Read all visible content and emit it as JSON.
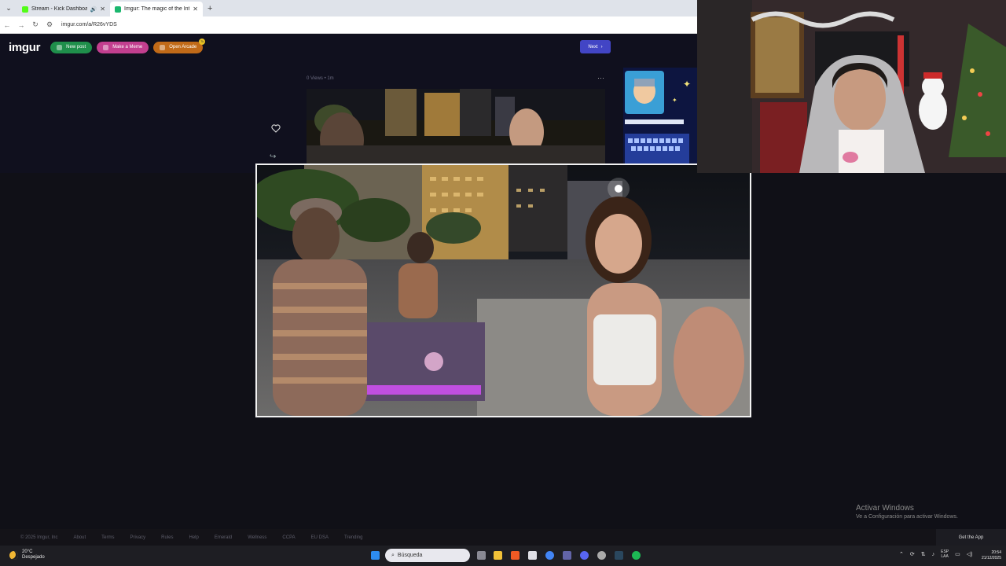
{
  "browser": {
    "tabs": [
      {
        "title": "Stream - Kick Dashboard",
        "favicon_color": "#53fc18"
      },
      {
        "title": "Imgur: The magic of the Internet",
        "favicon_color": "#1bb76e"
      }
    ],
    "url": "imgur.com/a/R26vYDS"
  },
  "imgur": {
    "logo": "imgur",
    "new_post": "New post",
    "make_meme": "Make a Meme",
    "open_arcade": "Open Arcade",
    "arcade_badge": "7k",
    "next": "Next",
    "post_meta": "0 Views • 1m"
  },
  "footer": {
    "copyright": "© 2025 Imgur, Inc",
    "links": [
      "About",
      "Terms",
      "Privacy",
      "Rules",
      "Help",
      "Emerald",
      "Wellness",
      "CCPA",
      "EU DSA",
      "Trending"
    ],
    "get_app": "Get the App"
  },
  "watermark": {
    "title": "Activar Windows",
    "subtitle": "Ve a Configuración para activar Windows."
  },
  "taskbar": {
    "temp": "20°C",
    "condition": "Despejado",
    "search_placeholder": "Búsqueda",
    "lang_top": "ESP",
    "lang_bottom": "LAA",
    "time": "20:54",
    "date": "21/12/2025"
  },
  "colors": {
    "accent": "#4245c5",
    "new_post": "#1f8f4b",
    "meme": "#c23f8f",
    "arcade": "#c16a18"
  }
}
